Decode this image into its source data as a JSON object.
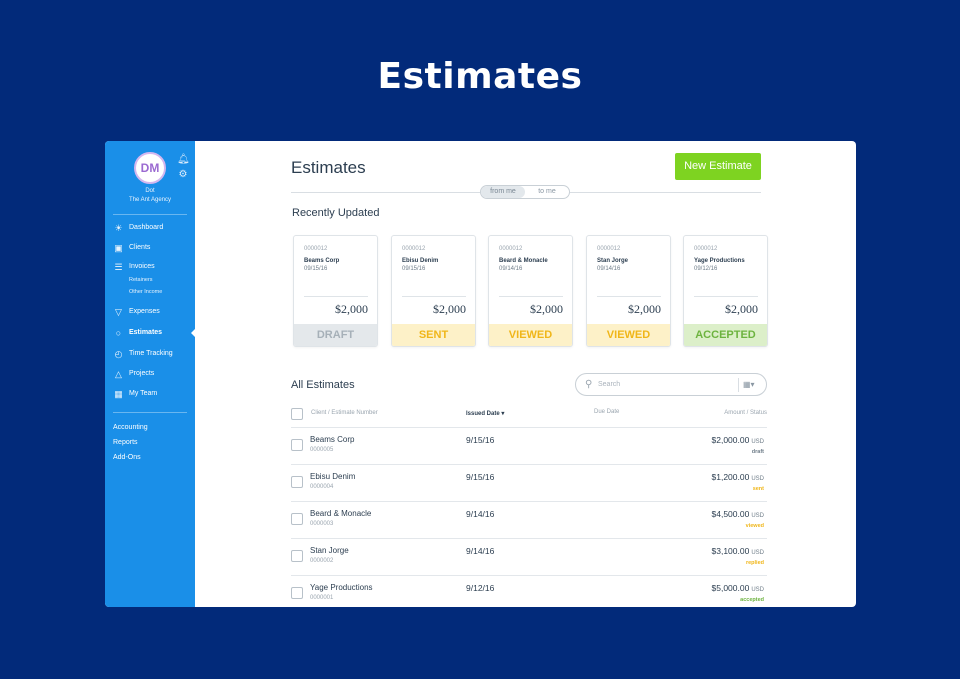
{
  "hero_title": "Estimates",
  "sidebar": {
    "avatar_initials": "DM",
    "user_name": "Dot",
    "user_org": "The Ant Agency",
    "items": [
      {
        "label": "Dashboard",
        "icon": "dashboard-sun-icon"
      },
      {
        "label": "Clients",
        "icon": "clients-icon"
      },
      {
        "label": "Invoices",
        "icon": "invoices-icon"
      },
      {
        "label": "Expenses",
        "icon": "expenses-icon"
      },
      {
        "label": "Estimates",
        "icon": "estimates-icon",
        "active": true
      },
      {
        "label": "Time Tracking",
        "icon": "stopwatch-icon"
      },
      {
        "label": "Projects",
        "icon": "flask-icon"
      },
      {
        "label": "My Team",
        "icon": "team-icon"
      }
    ],
    "invoice_subitems": [
      "Retainers",
      "Other Income"
    ],
    "links": [
      "Accounting",
      "Reports",
      "Add-Ons"
    ]
  },
  "header": {
    "title": "Estimates",
    "new_button": "New Estimate",
    "toggle": [
      "from me",
      "to me"
    ]
  },
  "recent": {
    "title": "Recently Updated",
    "cards": [
      {
        "number": "0000012",
        "client": "Beams Corp",
        "date": "09/15/16",
        "amount": "$2,000",
        "status": "DRAFT",
        "status_bg": "#e4e8eb",
        "status_color": "#a6b0b8"
      },
      {
        "number": "0000012",
        "client": "Ebisu Denim",
        "date": "09/15/16",
        "amount": "$2,000",
        "status": "SENT",
        "status_bg": "#fdf1c8",
        "status_color": "#f0b619"
      },
      {
        "number": "0000012",
        "client": "Beard & Monacle",
        "date": "09/14/16",
        "amount": "$2,000",
        "status": "VIEWED",
        "status_bg": "#fdf1c8",
        "status_color": "#f0b619"
      },
      {
        "number": "0000012",
        "client": "Stan Jorge",
        "date": "09/14/16",
        "amount": "$2,000",
        "status": "VIEWED",
        "status_bg": "#fdf1c8",
        "status_color": "#f0b619"
      },
      {
        "number": "0000012",
        "client": "Yage Productions",
        "date": "09/12/16",
        "amount": "$2,000",
        "status": "ACCEPTED",
        "status_bg": "#dcefc9",
        "status_color": "#6db33f"
      }
    ]
  },
  "all": {
    "title": "All Estimates",
    "search_placeholder": "Search",
    "columns": {
      "client": "Client / Estimate Number",
      "issued": "Issued Date ▾",
      "due": "Due Date",
      "amount": "Amount / Status"
    },
    "rows": [
      {
        "client": "Beams Corp",
        "number": "0000005",
        "date": "9/15/16",
        "amount": "$2,000.00",
        "currency": "USD",
        "status": "draft",
        "status_color": "#6f7d89"
      },
      {
        "client": "Ebisu Denim",
        "number": "0000004",
        "date": "9/15/16",
        "amount": "$1,200.00",
        "currency": "USD",
        "status": "sent",
        "status_color": "#f0b619"
      },
      {
        "client": "Beard & Monacle",
        "number": "0000003",
        "date": "9/14/16",
        "amount": "$4,500.00",
        "currency": "USD",
        "status": "viewed",
        "status_color": "#f0b619"
      },
      {
        "client": "Stan Jorge",
        "number": "0000002",
        "date": "9/14/16",
        "amount": "$3,100.00",
        "currency": "USD",
        "status": "replied",
        "status_color": "#f0b619"
      },
      {
        "client": "Yage Productions",
        "number": "0000001",
        "date": "9/12/16",
        "amount": "$5,000.00",
        "currency": "USD",
        "status": "accepted",
        "status_color": "#6db33f"
      }
    ]
  }
}
